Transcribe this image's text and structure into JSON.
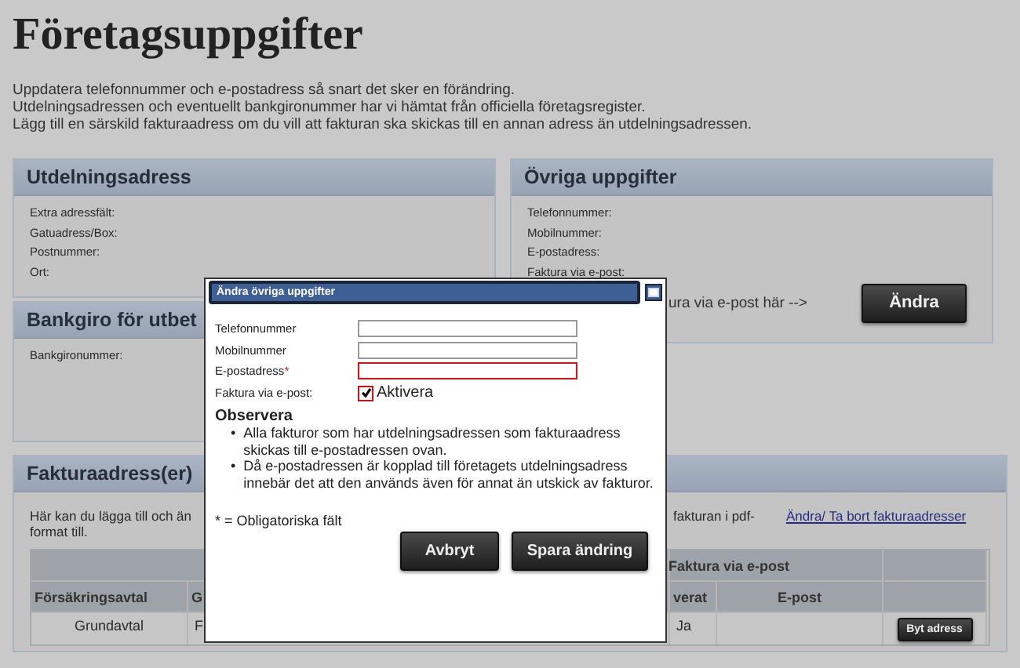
{
  "page": {
    "title": "Företagsuppgifter",
    "intro": [
      "Uppdatera telefonnummer och e-postadress så snart det sker en förändring.",
      "Utdelningsadressen och eventuellt bankgironummer har vi hämtat från officiella företagsregister.",
      "Lägg till en särskild fakturaadress om du vill att fakturan ska skickas till en annan adress än utdelningsadressen."
    ]
  },
  "delivery": {
    "title": "Utdelningsadress",
    "fields": [
      "Extra adressfält:",
      "Gatuadress/Box:",
      "Postnummer:",
      "Ort:"
    ]
  },
  "bankgiro": {
    "title": "Bankgiro för utbet",
    "fields": [
      "Bankgironummer:"
    ]
  },
  "other": {
    "title": "Övriga uppgifter",
    "fields": [
      "Telefonnummer:",
      "Mobilnummer:",
      "E-postadress:",
      "Faktura via e-post:"
    ],
    "hint": "ura via e-post här -->",
    "button": "Ändra"
  },
  "invoice": {
    "title": "Fakturaadress(er)",
    "text_left": [
      "Här kan du lägga till och än",
      "format till."
    ],
    "text_right": "fakturan i pdf-",
    "link": "Ändra/ Ta bort fakturaadresser",
    "table": {
      "group_header": "Faktura via e-post",
      "columns": [
        "Försäkringsavtal",
        "G",
        "verat",
        "E-post"
      ],
      "rows": [
        {
          "contract": "Grundavtal",
          "column_2": "F",
          "column_3": "Ja",
          "button": "Byt adress"
        }
      ]
    }
  },
  "modal": {
    "title": "Ändra övriga uppgifter",
    "fields": [
      {
        "label": "Telefonnummer",
        "required": false
      },
      {
        "label": "Mobilnummer",
        "required": false
      },
      {
        "label": "E-postadress",
        "required": true
      }
    ],
    "required_mark": "*",
    "checkbox": {
      "label": "Faktura via e-post:",
      "option": "Aktivera",
      "checked": true
    },
    "note_title": "Observera",
    "bullet": "•",
    "notes": [
      "Alla fakturor som har utdelningsadressen som fakturaadress skickas till e-postadressen ovan.",
      "Då e-postadressen är kopplad till företagets utdelningsadress innebär det att den används även för annat än utskick av fakturor."
    ],
    "legend": "* = Obligatoriska fält",
    "buttons": [
      "Avbryt",
      "Spara ändring"
    ]
  }
}
